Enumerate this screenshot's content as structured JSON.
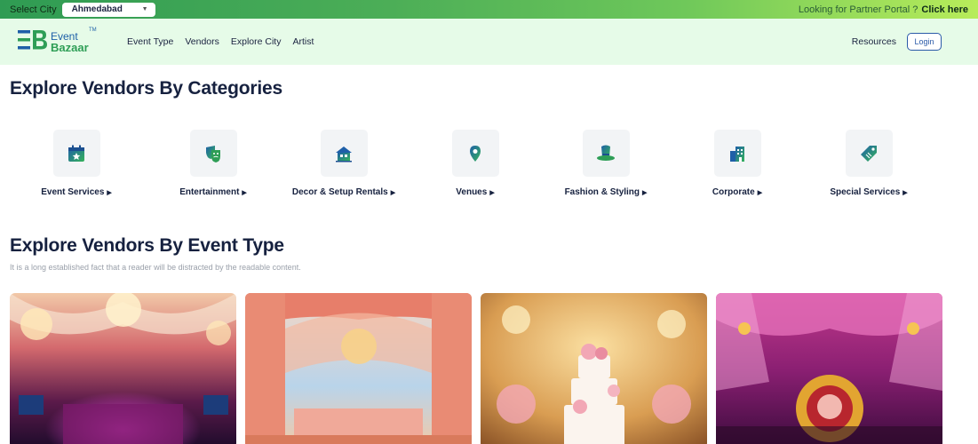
{
  "topbar": {
    "select_city_label": "Select City",
    "city_value": "Ahmedabad",
    "partner_text": "Looking for Partner Portal ?",
    "partner_link": "Click here"
  },
  "logo": {
    "mark": "EB",
    "line1": "Event",
    "line2": "Bazaar",
    "tm": "TM"
  },
  "nav": {
    "links": [
      "Event Type",
      "Vendors",
      "Explore City",
      "Artist"
    ],
    "resources": "Resources",
    "login": "Login"
  },
  "categories": {
    "title": "Explore Vendors By Categories",
    "items": [
      {
        "label": "Event Services",
        "icon": "calendar-star-icon"
      },
      {
        "label": "Entertainment",
        "icon": "theater-masks-icon"
      },
      {
        "label": "Decor & Setup Rentals",
        "icon": "decor-house-icon"
      },
      {
        "label": "Venues",
        "icon": "map-pin-icon"
      },
      {
        "label": "Fashion & Styling",
        "icon": "hat-icon"
      },
      {
        "label": "Corporate",
        "icon": "building-icon"
      },
      {
        "label": "Special Services",
        "icon": "tag-icon"
      }
    ]
  },
  "event_types": {
    "title": "Explore Vendors By Event Type",
    "subtitle": "It is a long established fact that a reader will be distracted by the readable content."
  },
  "colors": {
    "accent_blue": "#1e5fa8",
    "accent_green": "#2e9e56",
    "nav_bg": "#e6fbe8",
    "heading": "#16213f"
  }
}
